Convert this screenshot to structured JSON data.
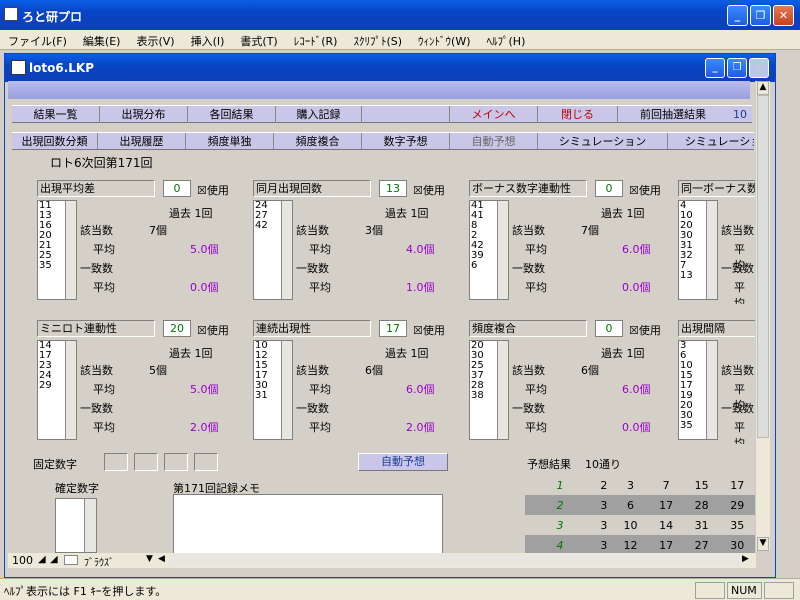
{
  "app": {
    "title": "ろと研プロ"
  },
  "menu": [
    "ファイル(F)",
    "編集(E)",
    "表示(V)",
    "挿入(I)",
    "書式(T)",
    "ﾚｺｰﾄﾞ(R)",
    "ｽｸﾘﾌﾟﾄ(S)",
    "ｳｨﾝﾄﾞｳ(W)",
    "ﾍﾙﾌﾟ(H)"
  ],
  "child": {
    "title": "loto6.LKP"
  },
  "row1": [
    "結果一覧",
    "出現分布",
    "各回結果",
    "購入記録",
    "",
    "メインへ",
    "閉じる",
    "前回抽選結果",
    "10"
  ],
  "row2": [
    "出現回数分類",
    "出現履歴",
    "頻度単独",
    "頻度複合",
    "数字予想",
    "自動予想",
    "シミュレーション",
    "シミュレーショ"
  ],
  "heading": "ロト6次回第171回",
  "panels": [
    {
      "title": "出現平均差",
      "num": "0",
      "check": "☒使用",
      "list": [
        "11",
        "13",
        "16",
        "20",
        "21",
        "25",
        "35"
      ],
      "kako": "過去 1回",
      "gaitou": "該当数",
      "gcount": "7個",
      "heikin1": "平均",
      "avg1": "5.0個",
      "itchi": "一致数",
      "heikin2": "平均",
      "avg2": "0.0個"
    },
    {
      "title": "同月出現回数",
      "num": "13",
      "check": "☒使用",
      "list": [
        "24",
        "27",
        "42"
      ],
      "kako": "過去 1回",
      "gaitou": "該当数",
      "gcount": "3個",
      "heikin1": "平均",
      "avg1": "4.0個",
      "itchi": "一致数",
      "heikin2": "平均",
      "avg2": "1.0個"
    },
    {
      "title": "ボーナス数字連動性",
      "num": "0",
      "check": "☒使用",
      "list": [
        "41",
        "41",
        "8",
        "2",
        "42",
        "39",
        "6"
      ],
      "kako": "過去 1回",
      "gaitou": "該当数",
      "gcount": "7個",
      "heikin1": "平均",
      "avg1": "6.0個",
      "itchi": "一致数",
      "heikin2": "平均",
      "avg2": "0.0個"
    },
    {
      "title": "同一ボーナス数",
      "num": "",
      "check": "",
      "list": [
        "4",
        "10",
        "20",
        "30",
        "31",
        "32",
        "7",
        "13"
      ],
      "kako": "",
      "gaitou": "該当数",
      "gcount": "",
      "heikin1": "平均",
      "avg1": "",
      "itchi": "一致数",
      "heikin2": "平均",
      "avg2": ""
    },
    {
      "title": "ミニロト連動性",
      "num": "20",
      "check": "☒使用",
      "list": [
        "14",
        "17",
        "23",
        "24",
        "29"
      ],
      "kako": "過去 1回",
      "gaitou": "該当数",
      "gcount": "5個",
      "heikin1": "平均",
      "avg1": "5.0個",
      "itchi": "一致数",
      "heikin2": "平均",
      "avg2": "2.0個"
    },
    {
      "title": "連続出現性",
      "num": "17",
      "check": "☒使用",
      "list": [
        "10",
        "12",
        "15",
        "17",
        "30",
        "31"
      ],
      "kako": "過去 1回",
      "gaitou": "該当数",
      "gcount": "6個",
      "heikin1": "平均",
      "avg1": "6.0個",
      "itchi": "一致数",
      "heikin2": "平均",
      "avg2": "2.0個"
    },
    {
      "title": "頻度複合",
      "num": "0",
      "check": "☒使用",
      "list": [
        "20",
        "30",
        "25",
        "37",
        "28",
        "38"
      ],
      "kako": "過去 1回",
      "gaitou": "該当数",
      "gcount": "6個",
      "heikin1": "平均",
      "avg1": "6.0個",
      "itchi": "一致数",
      "heikin2": "平均",
      "avg2": "0.0個"
    },
    {
      "title": "出現間隔",
      "num": "",
      "check": "",
      "list": [
        "3",
        "6",
        "10",
        "15",
        "17",
        "19",
        "20",
        "30",
        "35"
      ],
      "kako": "",
      "gaitou": "該当数",
      "gcount": "",
      "heikin1": "平均",
      "avg1": "",
      "itchi": "一致数",
      "heikin2": "平均",
      "avg2": ""
    }
  ],
  "fixed_label": "固定数字",
  "auto_button": "自動予想",
  "result_label": "予想結果",
  "result_count": "10通り",
  "kakutei_label": "確定数字",
  "memo_label": "第171回記録メモ",
  "results": [
    {
      "idx": "1",
      "nums": [
        "2",
        "3",
        "7",
        "15",
        "17"
      ]
    },
    {
      "idx": "2",
      "nums": [
        "3",
        "6",
        "17",
        "28",
        "29"
      ]
    },
    {
      "idx": "3",
      "nums": [
        "3",
        "10",
        "14",
        "31",
        "35"
      ]
    },
    {
      "idx": "4",
      "nums": [
        "3",
        "12",
        "17",
        "27",
        "30"
      ]
    }
  ],
  "nav": {
    "zoom": "100",
    "mode": "ﾌﾞﾗｳｽﾞ"
  },
  "status": {
    "help": "ﾍﾙﾌﾟ表示には F1 ｷｰを押します。",
    "num": "NUM"
  }
}
